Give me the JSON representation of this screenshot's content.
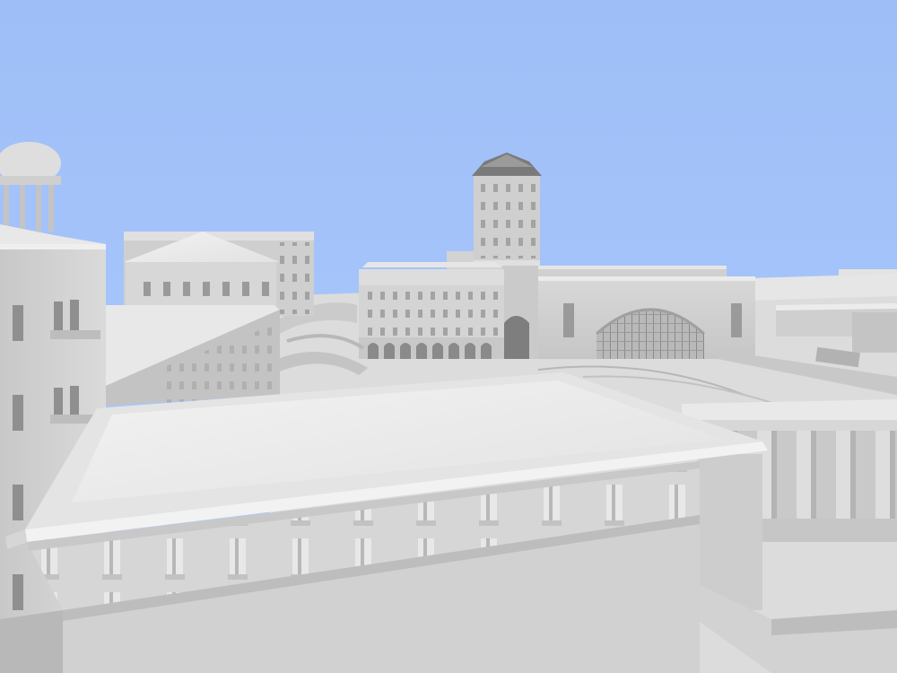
{
  "scene": {
    "description_tag": "untextured-3d-city-render",
    "colors": {
      "sky": "#a5c4fb",
      "sky_top": "#9fbff9",
      "building_light": "#e4e4e4",
      "building_mid": "#d2d2d2",
      "building_shadow": "#9c9c9c",
      "ground": "#dcdcdc",
      "window": "#8e8e8e"
    }
  }
}
